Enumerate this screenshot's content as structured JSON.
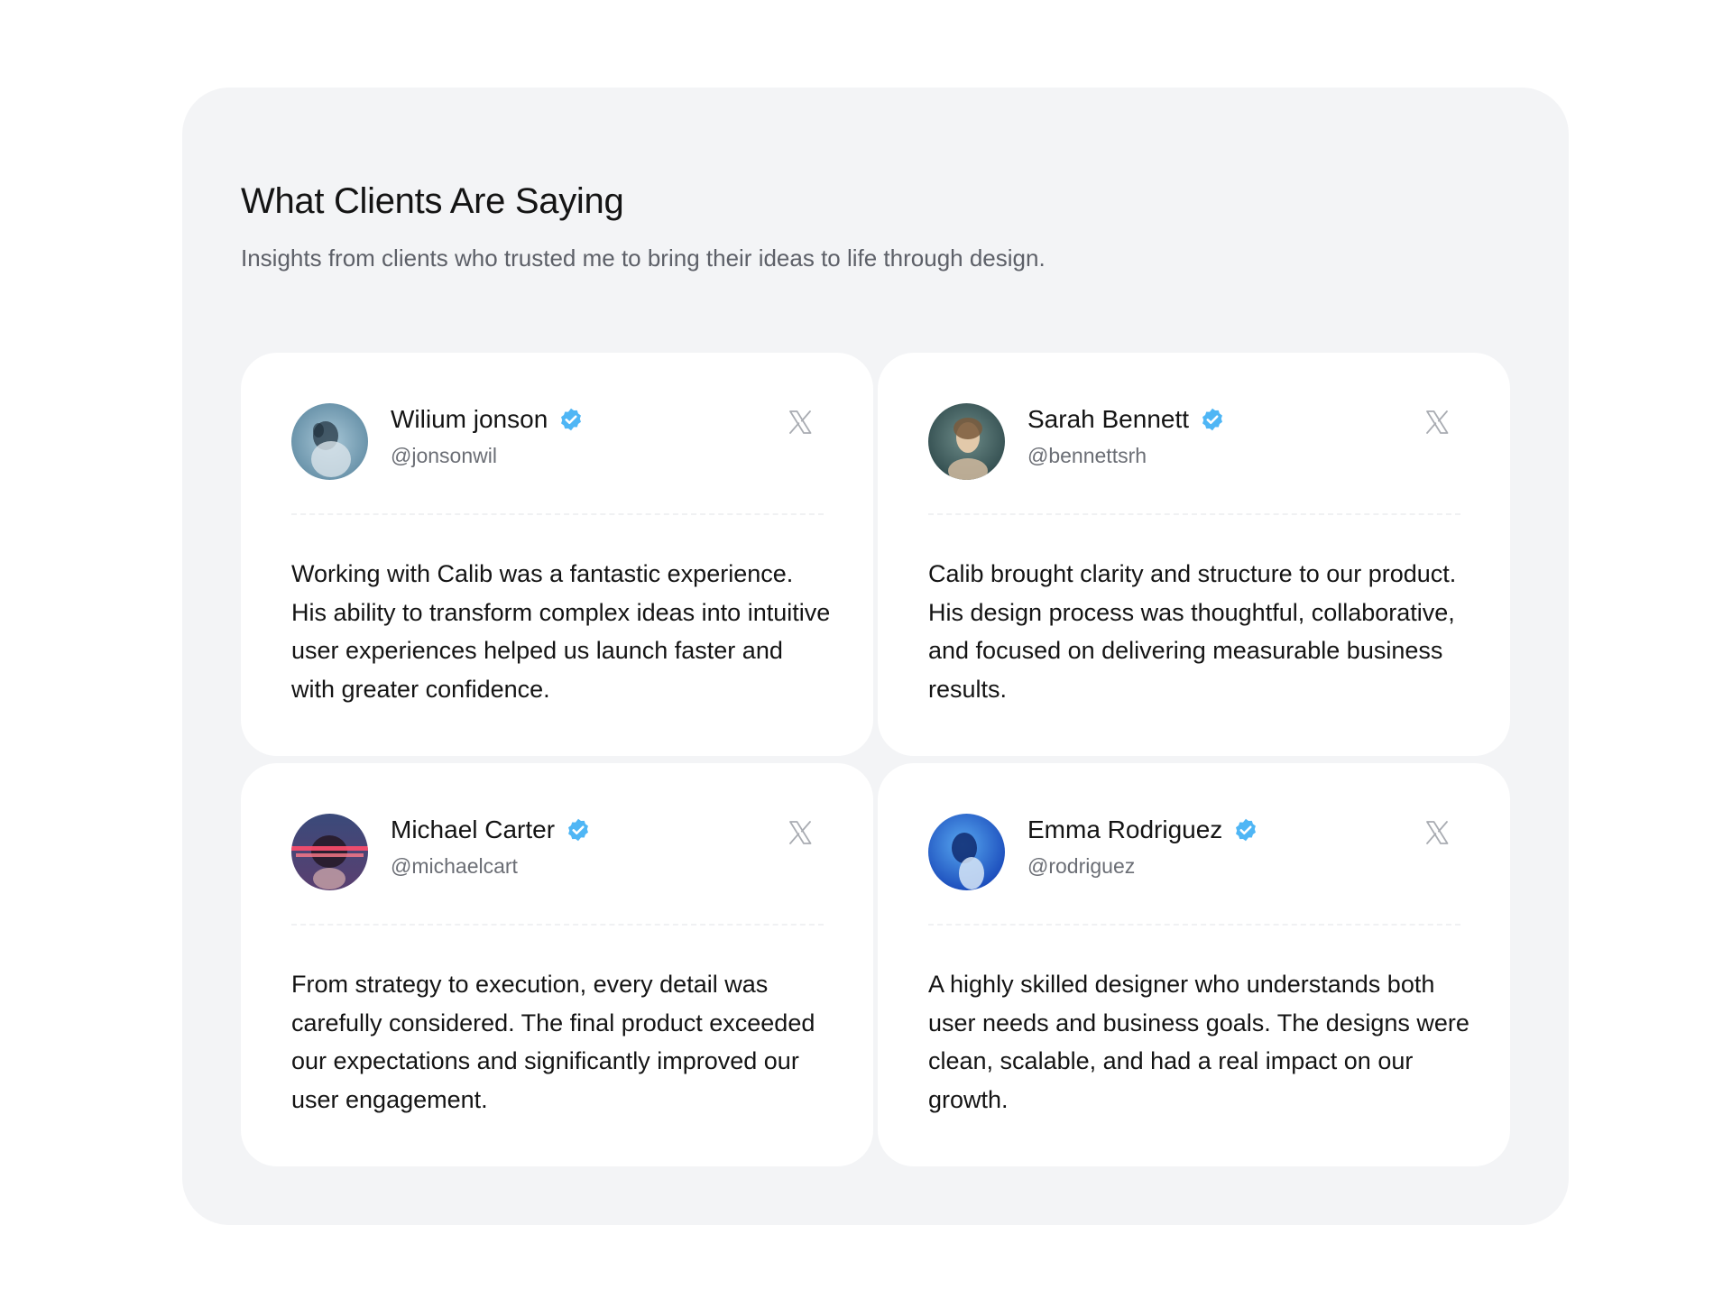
{
  "section": {
    "title": "What Clients Are Saying",
    "subtitle": "Insights from clients who trusted me to bring their ideas to life through design."
  },
  "colors": {
    "panel_background": "#f3f4f6",
    "card_background": "#ffffff",
    "verified_badge": "#4fb6f5",
    "x_icon": "#a9acb2"
  },
  "testimonials": [
    {
      "name": "Wilium jonson",
      "handle": "@jonsonwil",
      "quote": "Working with Calib was a fantastic experience. His ability to transform complex ideas into intuitive user experiences helped us launch faster and with greater confidence.",
      "verified_icon": "verified-badge-icon",
      "social_icon": "x-logo-icon"
    },
    {
      "name": "Sarah Bennett",
      "handle": "@bennettsrh",
      "quote": "Calib brought clarity and structure to our product. His design process was thoughtful, collaborative, and focused on delivering measurable business results.",
      "verified_icon": "verified-badge-icon",
      "social_icon": "x-logo-icon"
    },
    {
      "name": "Michael Carter",
      "handle": "@michaelcart",
      "quote": "From strategy to execution, every detail was carefully considered. The final product exceeded our expectations and significantly improved our user engagement.",
      "verified_icon": "verified-badge-icon",
      "social_icon": "x-logo-icon"
    },
    {
      "name": "Emma Rodriguez",
      "handle": "@rodriguez",
      "quote": "A highly skilled designer who understands both user needs and business goals. The designs were clean, scalable, and had a real impact on our growth.",
      "verified_icon": "verified-badge-icon",
      "social_icon": "x-logo-icon"
    }
  ]
}
